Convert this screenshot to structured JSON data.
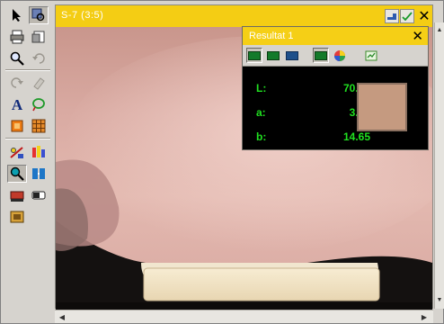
{
  "window": {
    "title": "S-7 (3:5)"
  },
  "result": {
    "title": "Resultat 1",
    "labels": {
      "l": "L:",
      "a": "a:",
      "b": "b:"
    },
    "values": {
      "l": "70.23",
      "a": "3.84",
      "b": "14.65"
    },
    "swatch_color": "#c59a80"
  },
  "colors": {
    "titlebar": "#f4cd14",
    "value_text": "#20e020"
  },
  "icons": {
    "toolbox": [
      "pointer-arrow-icon",
      "magnify-select-icon",
      "print-icon",
      "open-file-icon",
      "zoom-icon",
      "undo-icon",
      "redo-icon",
      "eraser-icon",
      "text-icon",
      "lasso-icon",
      "crop-icon",
      "grid-icon",
      "measure-icon",
      "palette-icon",
      "color-picker-icon",
      "compare-icon",
      "histogram-icon",
      "toggle-icon",
      "sample-icon"
    ],
    "result_toolbar": [
      "view-lab-icon",
      "view-lch-icon",
      "view-rgb-icon",
      "view-table-icon",
      "color-wheel-icon",
      "export-icon"
    ]
  }
}
